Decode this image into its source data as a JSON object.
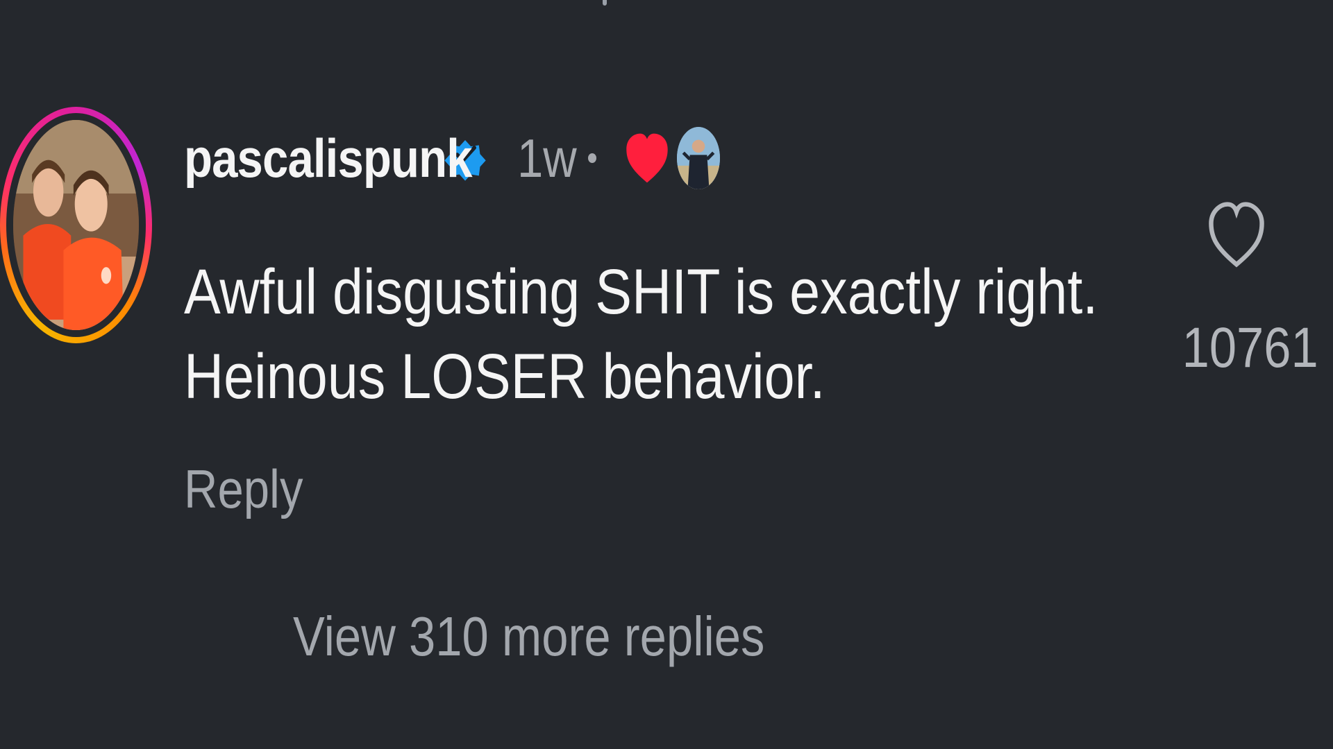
{
  "comment": {
    "username": "pascalispunk",
    "verified_icon": "verified-badge-icon",
    "timestamp": "1w",
    "creator_liked_icon": "heart-filled-icon",
    "text_line1": "Awful disgusting SHIT is exactly right.",
    "text_line2": "Heinous LOSER behavior.",
    "reply_label": "Reply",
    "like_icon": "heart-outline-icon",
    "like_count": "10761",
    "view_replies_label": "View 310 more replies"
  },
  "colors": {
    "background": "#25282d",
    "verified_blue": "#1d9bf0",
    "heart_red": "#ff1f3d",
    "muted_text": "#a3a7ad",
    "primary_text": "#f5f5f5"
  }
}
